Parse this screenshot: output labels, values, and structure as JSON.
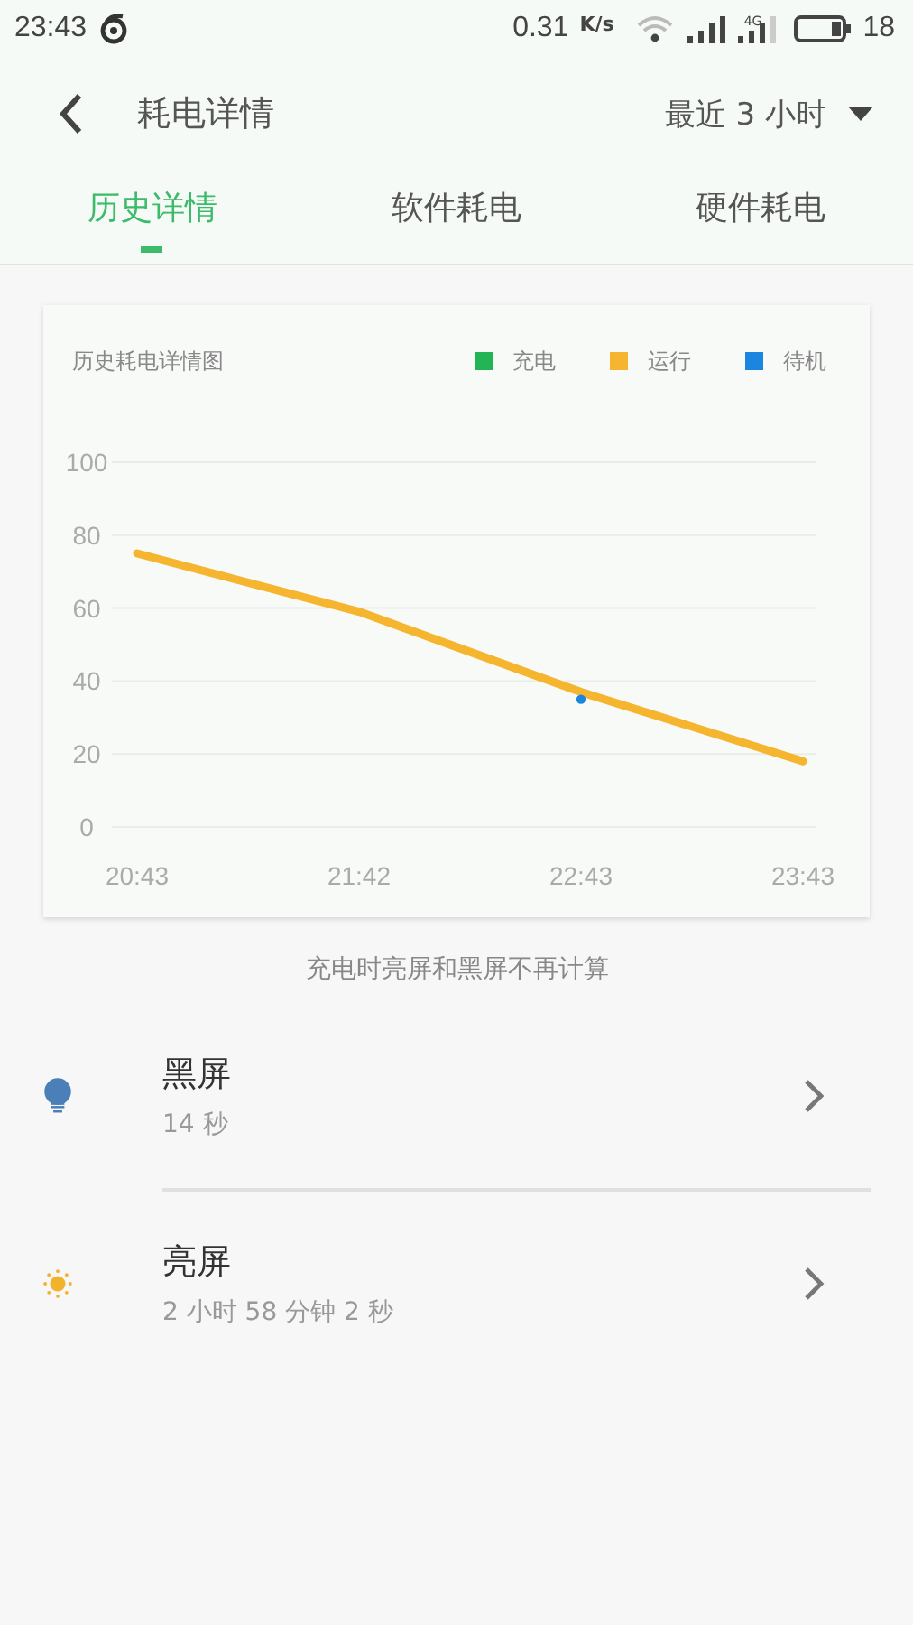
{
  "status_bar": {
    "time": "23:43",
    "speed": "0.31",
    "speed_unit": "K/s",
    "network": "4G",
    "battery": "18"
  },
  "header": {
    "title": "耗电详情",
    "range": "最近 3 小时"
  },
  "tabs": [
    {
      "label": "历史详情",
      "selected": true
    },
    {
      "label": "软件耗电",
      "selected": false
    },
    {
      "label": "硬件耗电",
      "selected": false
    }
  ],
  "chart_card": {
    "title": "历史耗电详情图",
    "chart_data": {
      "type": "line",
      "grid": true,
      "categories": [
        "20:43",
        "21:42",
        "22:43",
        "23:43"
      ],
      "ylim": [
        0,
        100
      ],
      "yticks": [
        0,
        20,
        40,
        60,
        80,
        100
      ],
      "series": [
        {
          "name": "充电",
          "color": "#22b455",
          "values": [
            null,
            null,
            null,
            null
          ]
        },
        {
          "name": "运行",
          "color": "#f5b52e",
          "values": [
            75,
            59,
            37,
            18
          ]
        },
        {
          "name": "待机",
          "color": "#1a86e0",
          "marker": "circle",
          "values": [
            null,
            null,
            35,
            null
          ]
        }
      ]
    }
  },
  "note": "充电时亮屏和黑屏不再计算",
  "items": [
    {
      "kind": "bulb",
      "title": "黑屏",
      "duration": "14 秒"
    },
    {
      "kind": "sun",
      "title": "亮屏",
      "duration": "2 小时 58 分钟 2 秒"
    }
  ]
}
